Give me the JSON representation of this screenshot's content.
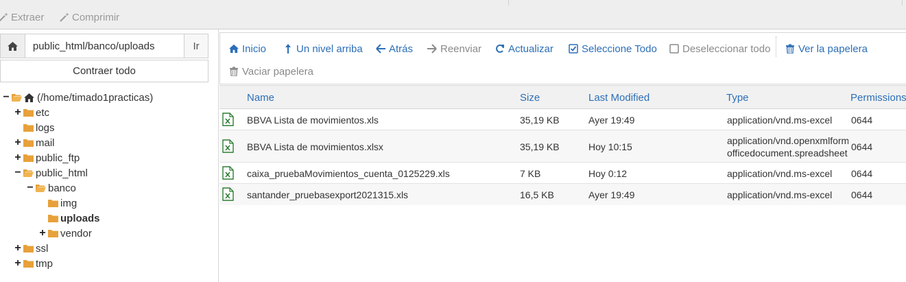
{
  "top_toolbar": {
    "extract_label": "Extraer",
    "compress_label": "Comprimir"
  },
  "left_panel": {
    "path_value": "public_html/banco/uploads",
    "go_label": "Ir",
    "collapse_label": "Contraer todo",
    "tree": {
      "root": "(/home/timado1practicas)",
      "etc": "etc",
      "logs": "logs",
      "mail": "mail",
      "public_ftp": "public_ftp",
      "public_html": "public_html",
      "banco": "banco",
      "img": "img",
      "uploads": "uploads",
      "vendor": "vendor",
      "ssl": "ssl",
      "tmp": "tmp"
    }
  },
  "toolbar": {
    "home": "Inicio",
    "up": "Un nivel arriba",
    "back": "Atrás",
    "forward": "Reenviar",
    "refresh": "Actualizar",
    "select_all": "Seleccione Todo",
    "deselect_all": "Deseleccionar todo",
    "view_trash": "Ver la papelera",
    "empty_trash": "Vaciar papelera"
  },
  "table": {
    "headers": {
      "name": "Name",
      "size": "Size",
      "modified": "Last Modified",
      "type": "Type",
      "permissions": "Permissions"
    },
    "rows": [
      {
        "name": "BBVA Lista de movimientos.xls",
        "size": "35,19 KB",
        "modified": "Ayer 19:49",
        "type": "application/vnd.ms-excel",
        "type2": "",
        "perm": "0644"
      },
      {
        "name": "BBVA Lista de movimientos.xlsx",
        "size": "35,19 KB",
        "modified": "Hoy 10:15",
        "type": "application/vnd.openxmlform",
        "type2": "officedocument.spreadsheet",
        "perm": "0644"
      },
      {
        "name": "caixa_pruebaMovimientos_cuenta_0125229.xls",
        "size": "7 KB",
        "modified": "Hoy 0:12",
        "type": "application/vnd.ms-excel",
        "type2": "",
        "perm": "0644"
      },
      {
        "name": "santander_pruebasexport2021315.xls",
        "size": "16,5 KB",
        "modified": "Ayer 19:49",
        "type": "application/vnd.ms-excel",
        "type2": "",
        "perm": "0644"
      }
    ]
  },
  "colors": {
    "link_blue": "#2c6fb7",
    "folder_orange": "#e8a13a",
    "excel_green": "#2e7d32"
  }
}
